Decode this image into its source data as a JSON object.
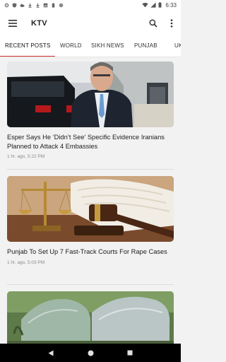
{
  "status_bar": {
    "time": "6:33",
    "icons": [
      "settings-icon",
      "shield-icon",
      "cloud-icon",
      "download-icon",
      "download-icon",
      "image-icon",
      "battery-saver-icon",
      "circle-icon"
    ],
    "right_icons": [
      "wifi-icon",
      "signal-icon",
      "battery-icon"
    ]
  },
  "app_bar": {
    "title": "KTV",
    "menu_icon": "menu-icon",
    "search_icon": "search-icon",
    "more_icon": "more-vert-icon"
  },
  "tabs": [
    {
      "label": "RECENT POSTS",
      "active": true
    },
    {
      "label": "WORLD",
      "active": false
    },
    {
      "label": "SIKH NEWS",
      "active": false
    },
    {
      "label": "PUNJAB",
      "active": false
    },
    {
      "label": "UK",
      "active": false
    }
  ],
  "accent_color": "#d32f2f",
  "articles": [
    {
      "title": "Esper Says He ‘Didn’t See’ Specific Evidence Iranians Planned to Attack 4 Embassies",
      "time": "1 hr. ago, 5:22 PM"
    },
    {
      "title": "Punjab To Set Up 7 Fast-Track Courts For Rape Cases",
      "time": "1 hr. ago, 5:03 PM"
    },
    {
      "title": "",
      "time": ""
    }
  ],
  "nav_bar": {
    "icons": [
      "back-icon",
      "home-icon",
      "recents-icon"
    ]
  }
}
